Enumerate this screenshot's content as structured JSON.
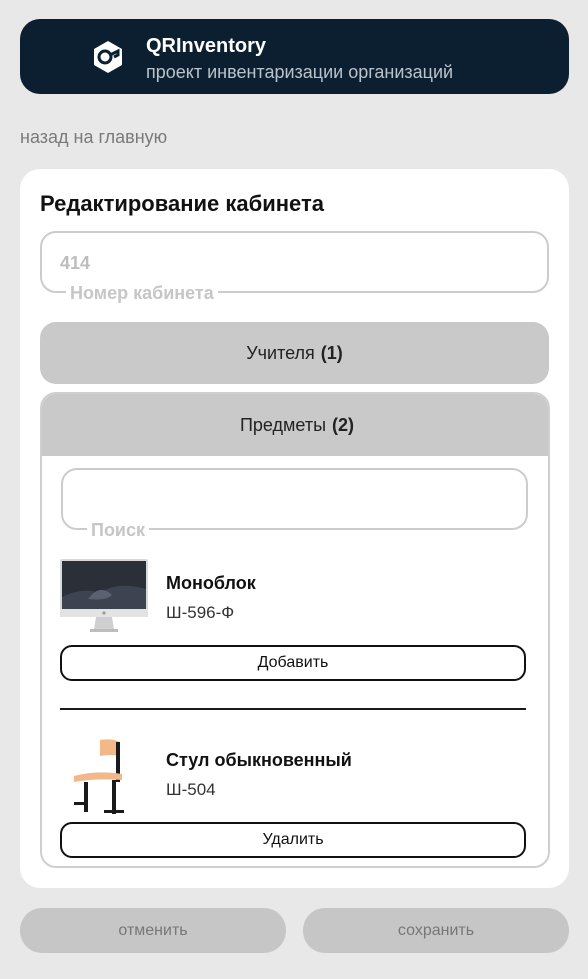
{
  "header": {
    "app_name": "QRInventory",
    "subtitle": "проект инвентаризации организаций",
    "logo_icon": "hexagon-key-icon"
  },
  "nav": {
    "back_label": "назад на главную"
  },
  "form": {
    "title": "Редактирование кабинета",
    "room_number": {
      "value": "414",
      "label": "Номер кабинета"
    },
    "teachers": {
      "label": "Учителя",
      "count": "(1)"
    },
    "subjects": {
      "label": "Предметы",
      "count": "(2)"
    },
    "search": {
      "value": "",
      "label": "Поиск"
    },
    "items": [
      {
        "name": "Моноблок",
        "code": "Ш-596-Ф",
        "action": "Добавить",
        "image": "imac-icon"
      },
      {
        "name": "Стул обыкновенный",
        "code": "Ш-504",
        "action": "Удалить",
        "image": "chair-icon"
      }
    ]
  },
  "footer": {
    "cancel_label": "отменить",
    "save_label": "сохранить"
  },
  "colors": {
    "header_bg": "#0c1f30",
    "page_bg": "#e8e8e8",
    "accordion_bg": "#c9c9c9",
    "button_bg": "#c6c6c6"
  }
}
